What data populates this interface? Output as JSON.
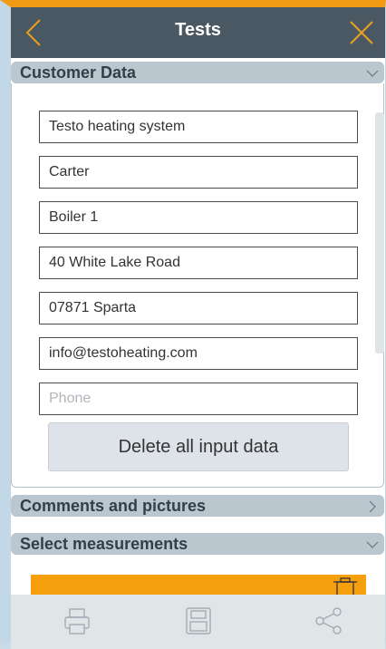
{
  "header": {
    "title": "Tests",
    "back_icon": "chevron-left-icon",
    "close_icon": "close-icon",
    "accent": "#f29a12",
    "background": "#4a5863"
  },
  "customer": {
    "title": "Customer Data",
    "fields": [
      {
        "value": "Testo heating system",
        "placeholder": ""
      },
      {
        "value": "Carter",
        "placeholder": ""
      },
      {
        "value": "Boiler 1",
        "placeholder": ""
      },
      {
        "value": "40 White Lake Road",
        "placeholder": ""
      },
      {
        "value": "07871 Sparta",
        "placeholder": ""
      },
      {
        "value": "info@testoheating.com",
        "placeholder": ""
      },
      {
        "value": "",
        "placeholder": "Phone"
      }
    ],
    "delete_label": "Delete all input data"
  },
  "sections": {
    "comments": "Comments and pictures",
    "measurements": "Select measurements"
  },
  "toolbar": {
    "print_icon": "printer-icon",
    "save_icon": "save-icon",
    "share_icon": "share-icon"
  }
}
